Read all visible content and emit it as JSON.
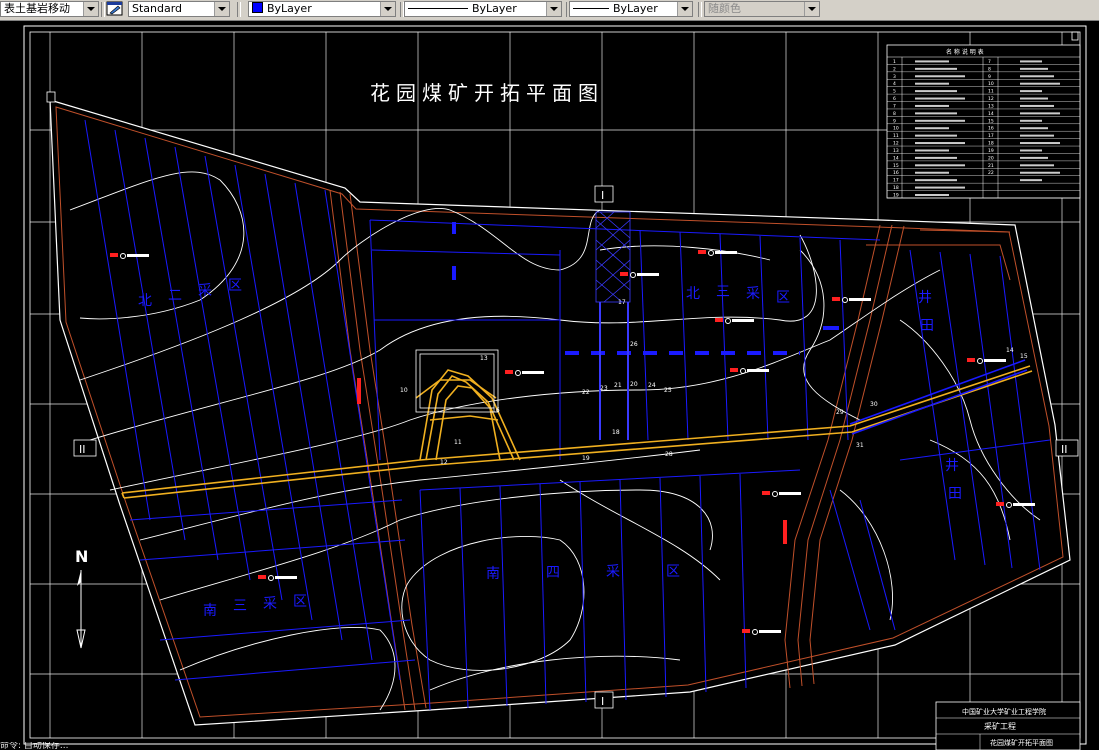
{
  "toolbar": {
    "layer_name": "表土基岩移动",
    "text_style": "Standard",
    "color": "ByLayer",
    "color_hex": "#0000ff",
    "linetype": "ByLayer",
    "lineweight": "ByLayer",
    "plot_style": "随颜色"
  },
  "drawing": {
    "title": "花园煤矿开拓平面图",
    "north": "N",
    "section_label": "I",
    "section_label_2": "II",
    "regions": {
      "north_two": [
        "北",
        "二",
        "采",
        "区"
      ],
      "north_three": [
        "北",
        "三",
        "采",
        "区"
      ],
      "south_three": [
        "南",
        "三",
        "采",
        "区"
      ],
      "south_four": [
        "南",
        "四",
        "采",
        "区"
      ],
      "east_top": [
        "井",
        "田"
      ],
      "east_bottom": [
        "井",
        "田"
      ]
    },
    "title_block": {
      "school": "中国矿业大学矿业工程学院",
      "project": "采矿工程",
      "drawing_name": "花园煤矿开拓平面图"
    },
    "legend_title": "名 称 说 明 表",
    "legend_numbers": [
      "1",
      "2",
      "3",
      "4",
      "5",
      "6",
      "7",
      "8",
      "9",
      "10",
      "11",
      "12",
      "13",
      "14",
      "15",
      "16",
      "17",
      "18",
      "19",
      "20",
      "21",
      "22",
      "23",
      "24",
      "25"
    ],
    "point_labels": [
      "22",
      "23",
      "21",
      "20",
      "24",
      "25",
      "26",
      "17",
      "18",
      "19",
      "28",
      "29",
      "30",
      "31",
      "10",
      "11",
      "12",
      "13",
      "14",
      "15",
      "16"
    ]
  },
  "command_line": "命令: 自动保存..."
}
